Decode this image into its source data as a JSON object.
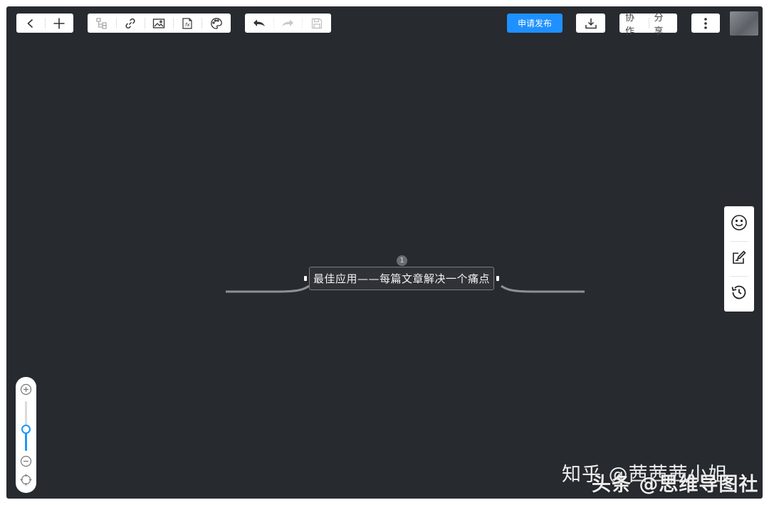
{
  "toolbar": {
    "back_icon": "chevron-left-icon",
    "add_icon": "plus-icon",
    "insert_icons": [
      "subtopic-tree-icon",
      "link-icon",
      "image-icon",
      "formula-icon",
      "palette-icon"
    ],
    "history_icons": [
      "undo-icon",
      "redo-icon",
      "save-icon"
    ],
    "publish_label": "申请发布",
    "download_icon": "download-icon",
    "collaborate_label": "协作",
    "share_label": "分享",
    "more_icon": "more-vertical-icon",
    "accent_color": "#1e90ff"
  },
  "mindmap": {
    "root_topic": "最佳应用——每篇文章解决一个痛点",
    "collapsed_badge": "1"
  },
  "right_panel": {
    "icons": [
      "emoji-icon",
      "note-edit-icon",
      "history-icon"
    ]
  },
  "zoom": {
    "zoom_in_icon": "zoom-in-icon",
    "zoom_out_icon": "zoom-out-icon",
    "locate_icon": "locate-center-icon",
    "level_fraction": 0.45
  },
  "watermark": {
    "line1": "知乎 @茜茜茜小姐",
    "line2": "头条 @思维导图社"
  }
}
